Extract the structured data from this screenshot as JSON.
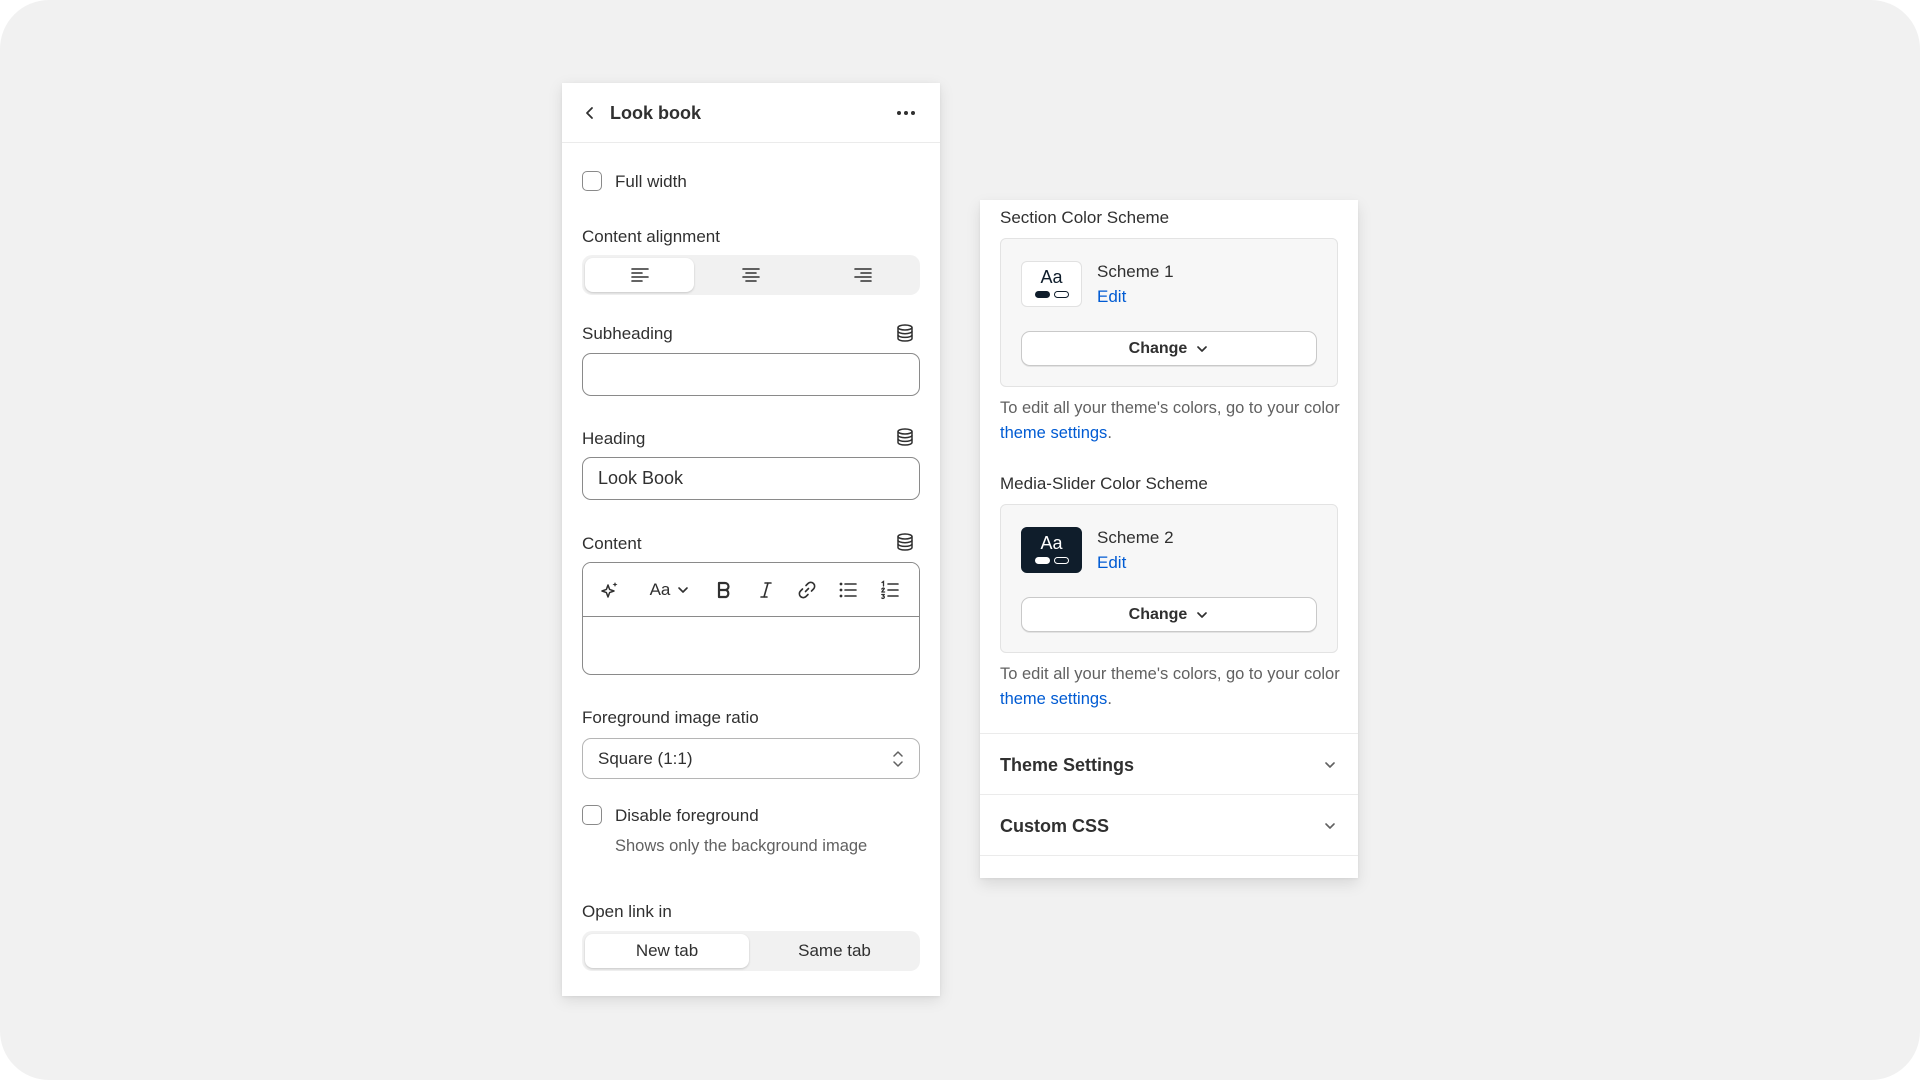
{
  "editor": {
    "title": "Look book",
    "full_width_label": "Full width",
    "content_alignment_label": "Content alignment",
    "alignment_options": [
      "left",
      "center",
      "right"
    ],
    "subheading_label": "Subheading",
    "subheading_value": "",
    "heading_label": "Heading",
    "heading_value": "Look Book",
    "content_label": "Content",
    "rte_font_button": "Aa",
    "foreground_ratio_label": "Foreground image ratio",
    "foreground_ratio_value": "Square (1:1)",
    "disable_foreground_label": "Disable foreground",
    "disable_foreground_help": "Shows only the background image",
    "open_link_label": "Open link in",
    "open_link_options": [
      "New tab",
      "Same tab"
    ],
    "open_link_selected": "New tab"
  },
  "colors": {
    "section_label": "Section Color Scheme",
    "section_scheme": {
      "name": "Scheme 1",
      "edit": "Edit",
      "swatch_text": "Aa",
      "bg": "#ffffff",
      "fg": "#0f1d2b"
    },
    "media_label": "Media-Slider Color Scheme",
    "media_scheme": {
      "name": "Scheme 2",
      "edit": "Edit",
      "swatch_text": "Aa",
      "bg": "#0f1d2b",
      "fg": "#ffffff"
    },
    "change_label": "Change",
    "note_prefix": "To edit all your theme's colors, go to your color ",
    "note_link": "theme settings",
    "note_suffix": "."
  },
  "accordions": {
    "theme_settings": "Theme Settings",
    "custom_css": "Custom CSS"
  },
  "accent": "#005bd3"
}
